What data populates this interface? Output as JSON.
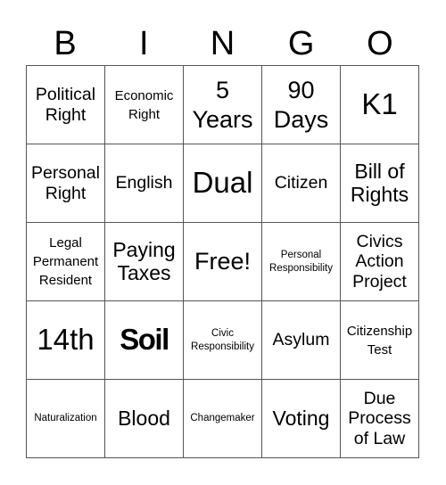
{
  "header": {
    "letters": [
      "B",
      "I",
      "N",
      "G",
      "O"
    ]
  },
  "board": {
    "rows": [
      [
        {
          "text": "Political Right",
          "size": "s-md"
        },
        {
          "text": "Economic Right",
          "size": "s-sm"
        },
        {
          "text": "5 Years",
          "size": "s-xl"
        },
        {
          "text": "90 Days",
          "size": "s-xl"
        },
        {
          "text": "K1",
          "size": "s-xxl"
        }
      ],
      [
        {
          "text": "Personal Right",
          "size": "s-md"
        },
        {
          "text": "English",
          "size": "s-md"
        },
        {
          "text": "Dual",
          "size": "s-xxl"
        },
        {
          "text": "Citizen",
          "size": "s-md"
        },
        {
          "text": "Bill of Rights",
          "size": "s-lg"
        }
      ],
      [
        {
          "text": "Legal Permanent Resident",
          "size": "s-sm"
        },
        {
          "text": "Paying Taxes",
          "size": "s-lg"
        },
        {
          "text": "Free!",
          "size": "s-xl"
        },
        {
          "text": "Personal Responsibility",
          "size": "s-xs"
        },
        {
          "text": "Civics Action Project",
          "size": "s-md"
        }
      ],
      [
        {
          "text": "14th",
          "size": "s-xxl"
        },
        {
          "text": "Soil",
          "size": "s-xxl",
          "bold": true
        },
        {
          "text": "Civic Responsibility",
          "size": "s-xs"
        },
        {
          "text": "Asylum",
          "size": "s-md"
        },
        {
          "text": "Citizenship Test",
          "size": "s-sm"
        }
      ],
      [
        {
          "text": "Naturalization",
          "size": "s-xs"
        },
        {
          "text": "Blood",
          "size": "s-lg"
        },
        {
          "text": "Changemaker",
          "size": "s-xs"
        },
        {
          "text": "Voting",
          "size": "s-lg"
        },
        {
          "text": "Due Process of Law",
          "size": "s-md"
        }
      ]
    ]
  }
}
